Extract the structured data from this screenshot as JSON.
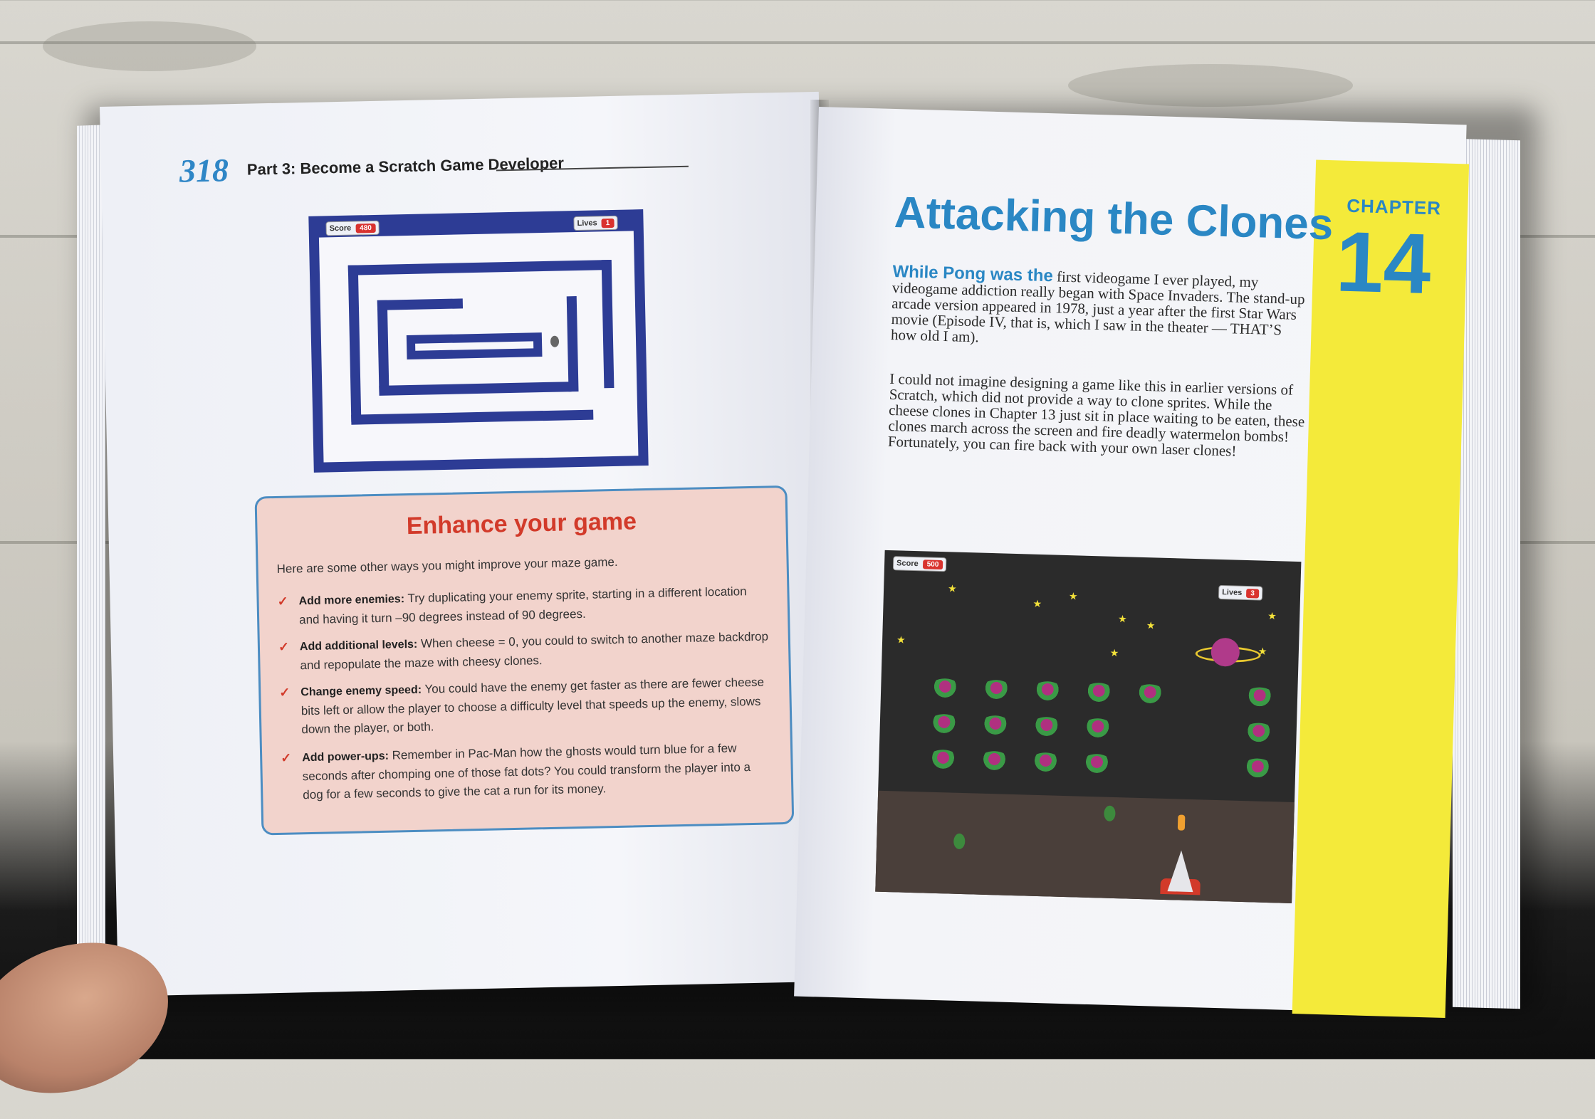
{
  "left_page": {
    "page_number": "318",
    "running_head": "Part 3: Become a Scratch Game Developer",
    "maze_game": {
      "score_label": "Score",
      "score_value": "480",
      "lives_label": "Lives",
      "lives_value": "1"
    },
    "sidebar": {
      "title": "Enhance your game",
      "intro": "Here are some other ways you might improve your maze game.",
      "tips": [
        {
          "title": "Add more enemies:",
          "text": "Try duplicating your enemy sprite, starting in a different location and having it turn –90 degrees instead of 90 degrees."
        },
        {
          "title": "Add additional levels:",
          "text": "When cheese = 0, you could to switch to another maze backdrop and repopulate the maze with cheesy clones."
        },
        {
          "title": "Change enemy speed:",
          "text": "You could have the enemy get faster as there are fewer cheese bits left or allow the player to choose a difficulty level that speeds up the enemy, slows down the player, or both."
        },
        {
          "title": "Add power-ups:",
          "text": "Remember in Pac-Man how the ghosts would turn blue for a few seconds after chomping one of those fat dots? You could transform the player into a dog for a few seconds to give the cat a run for its money."
        }
      ]
    }
  },
  "right_page": {
    "chapter_label": "CHAPTER",
    "chapter_number": "14",
    "title": "Attacking the Clones",
    "paragraph1_lead": "While Pong was the",
    "paragraph1": "first videogame I ever played, my videogame addiction really began with Space Invaders. The stand-up arcade version appeared in 1978, just a year after the first Star Wars movie (Episode IV, that is, which I saw in the theater — THAT’S how old I am).",
    "paragraph2": "I could not imagine designing a game like this in earlier versions of Scratch, which did not provide a way to clone sprites. While the cheese clones in Chapter 13 just sit in place waiting to be eaten, these clones march across the screen and fire deadly watermelon bombs! Fortunately, you can fire back with your own laser clones!",
    "invaders_game": {
      "score_label": "Score",
      "score_value": "500",
      "lives_label": "Lives",
      "lives_value": "3"
    }
  },
  "colors": {
    "accent_blue": "#2a87c4",
    "sidebar_red": "#d23a2a",
    "chapter_yellow": "#f4ea3a",
    "maze_blue": "#2d3c95"
  }
}
